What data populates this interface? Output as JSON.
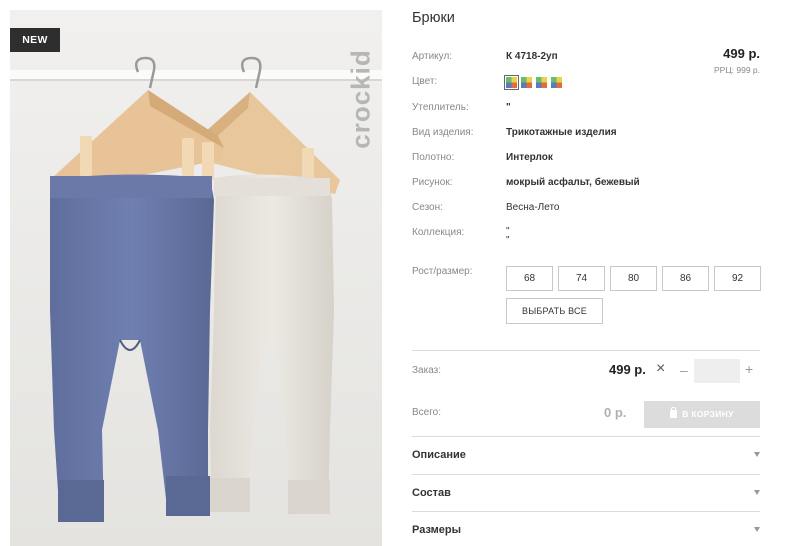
{
  "image": {
    "badge": "NEW",
    "brand": "crockid"
  },
  "product": {
    "title": "Брюки",
    "price": "499 р.",
    "rrp": "РРЦ: 999 р."
  },
  "specs": [
    {
      "label": "Артикул:",
      "value": "К 4718-2уп"
    },
    {
      "label": "Цвет:",
      "value": ""
    },
    {
      "label": "Утеплитель:",
      "value": "\""
    },
    {
      "label": "Вид изделия:",
      "value": "Трикотажные изделия"
    },
    {
      "label": "Полотно:",
      "value": "Интерлок"
    },
    {
      "label": "Рисунок:",
      "value": "мокрый асфальт, бежевый"
    },
    {
      "label": "Сезон:",
      "value": "Весна-Лето"
    },
    {
      "label": "Коллекция:",
      "value": "\"\n\""
    }
  ],
  "colors": {
    "swatch_count": 4,
    "selected_index": 0
  },
  "sizes": {
    "label": "Рост/размер:",
    "options": [
      "68",
      "74",
      "80",
      "86",
      "92"
    ],
    "select_all": "ВЫБРАТЬ ВСЕ"
  },
  "order": {
    "label": "Заказ:",
    "price": "499 р.",
    "remove_symbol": "×",
    "minus": "–",
    "plus": "+",
    "quantity": ""
  },
  "total": {
    "label": "Всего:",
    "value": "0 р.",
    "cart_button": "В КОРЗИНУ"
  },
  "accordions": [
    {
      "label": "Описание"
    },
    {
      "label": "Состав"
    },
    {
      "label": "Размеры"
    }
  ]
}
